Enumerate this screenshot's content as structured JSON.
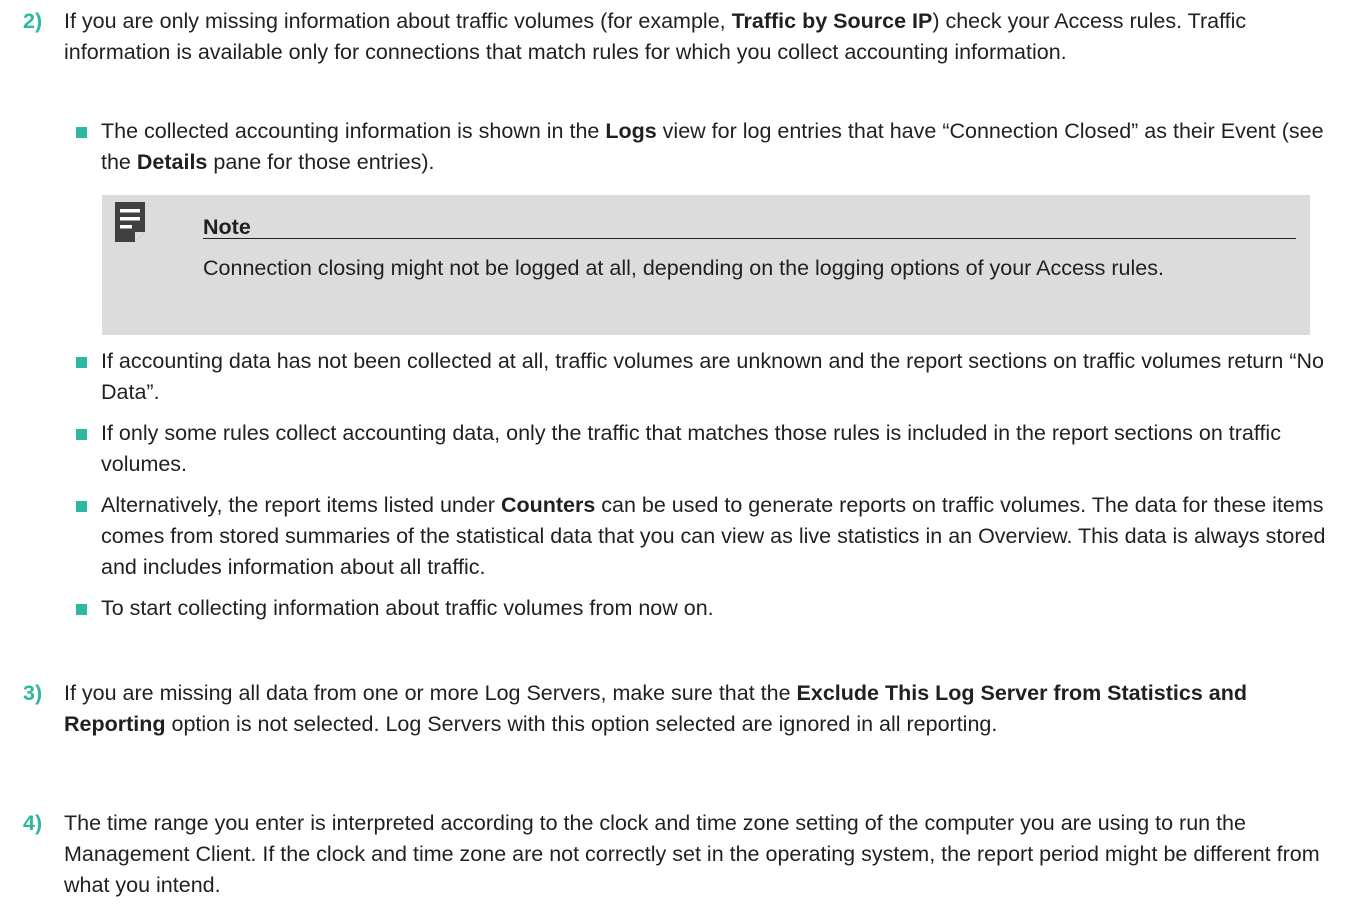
{
  "step2": {
    "number": "2)",
    "t1": "If you are only missing information about traffic volumes (for example, ",
    "b1": "Traffic by Source IP",
    "t2": ") check your Access rules. Traffic information is available only for connections that match rules for which you collect accounting information."
  },
  "bullet1": {
    "t1": "The collected accounting information is shown in the ",
    "b1": "Logs",
    "t2": " view for log entries that have “Connection Closed” as their Event (see the ",
    "b2": "Details",
    "t3": " pane for those entries)."
  },
  "note": {
    "icon": "note-icon",
    "title": "Note",
    "body": "Connection closing might not be logged at all, depending on the logging options of your Access rules."
  },
  "bullet2": "If accounting data has not been collected at all, traffic volumes are unknown and the report sections on traffic volumes return “No Data”.",
  "bullet3": "If only some rules collect accounting data, only the traffic that matches those rules is included in the report sections on traffic volumes.",
  "bullet4": {
    "t1": "Alternatively, the report items listed under ",
    "b1": "Counters",
    "t2": " can be used to generate reports on traffic volumes. The data for these items comes from stored summaries of the statistical data that you can view as live statistics in an Overview. This data is always stored and includes information about all traffic."
  },
  "bullet5": "To start collecting information about traffic volumes from now on.",
  "step3": {
    "number": "3)",
    "t1": "If you are missing all data from one or more Log Servers, make sure that the ",
    "b1": "Exclude This Log Server from Statistics and Reporting",
    "t2": " option is not selected. Log Servers with this option selected are ignored in all reporting."
  },
  "step4": {
    "number": "4)",
    "text": "The time range you enter is interpreted according to the clock and time zone setting of the computer you are using to run the Management Client. If the clock and time zone are not correctly set in the operating system, the report period might be different from what you intend."
  },
  "colors": {
    "accent": "#2db9a0",
    "note_bg": "#dcdcdc",
    "icon": "#404040",
    "text": "#231f20"
  }
}
